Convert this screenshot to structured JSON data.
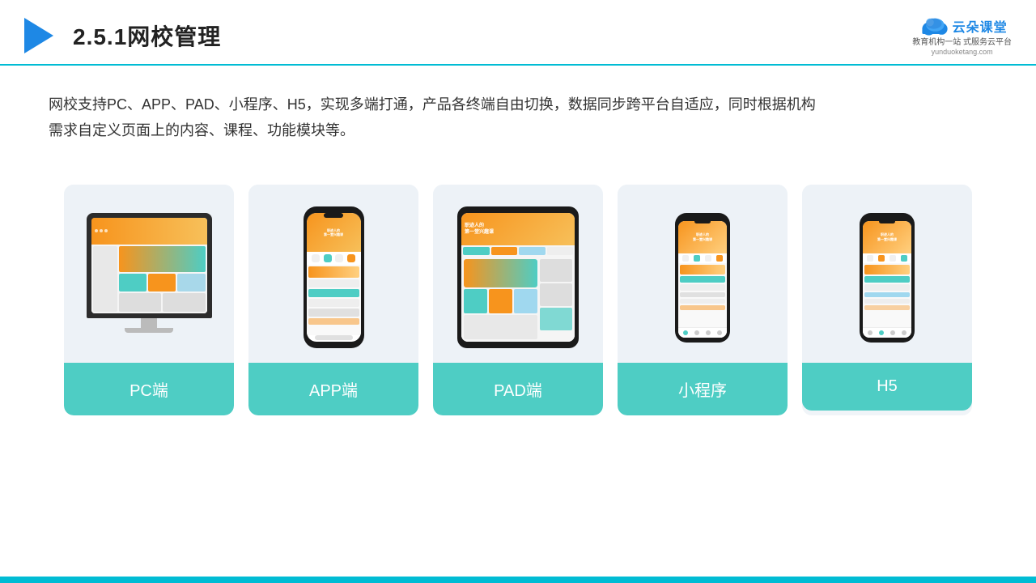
{
  "header": {
    "title": "2.5.1网校管理",
    "logo_text": "云朵课堂",
    "logo_url": "yunduoketang.com",
    "logo_tagline": "教育机构一站\n式服务云平台"
  },
  "description": {
    "text": "网校支持PC、APP、PAD、小程序、H5，实现多端打通，产品各终端自由切换，数据同步跨平台自适应，同时根据机构需求自定义页面上的内容、课程、功能模块等。"
  },
  "cards": [
    {
      "label": "PC端",
      "type": "pc"
    },
    {
      "label": "APP端",
      "type": "phone"
    },
    {
      "label": "PAD端",
      "type": "pad"
    },
    {
      "label": "小程序",
      "type": "phone-small"
    },
    {
      "label": "H5",
      "type": "phone-small"
    }
  ]
}
